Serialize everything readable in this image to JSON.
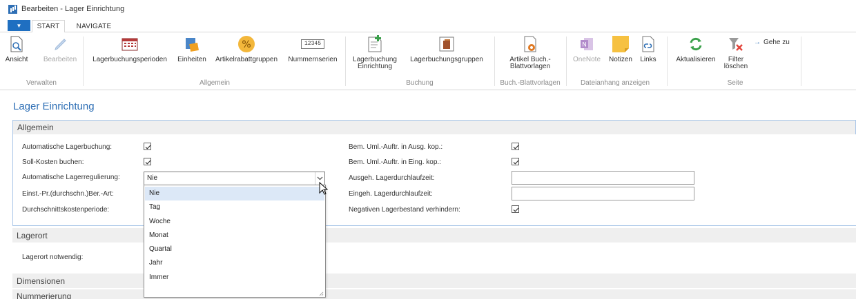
{
  "window": {
    "title": "Bearbeiten - Lager Einrichtung"
  },
  "tabs": {
    "start": "START",
    "navigate": "NAVIGATE"
  },
  "ribbon": {
    "ansicht": "Ansicht",
    "bearbeiten": "Bearbeiten",
    "verwalten": "Verwalten",
    "lagerbuchungsperioden": "Lagerbuchungsperioden",
    "einheiten": "Einheiten",
    "artikelrabattgruppen": "Artikelrabattgruppen",
    "nummernserien": "Nummernserien",
    "nummernserien_icon_text": "12345",
    "allgemein": "Allgemein",
    "lagerbuchung_einrichtung_1": "Lagerbuchung",
    "lagerbuchung_einrichtung_2": "Einrichtung",
    "lagerbuchungsgruppen": "Lagerbuchungsgruppen",
    "buchung": "Buchung",
    "artikel_buch_1": "Artikel Buch.-",
    "artikel_buch_2": "Blattvorlagen",
    "buchblatt_group": "Buch.-Blattvorlagen",
    "onenote": "OneNote",
    "notizen": "Notizen",
    "links": "Links",
    "dateianhang": "Dateianhang anzeigen",
    "aktualisieren": "Aktualisieren",
    "filter_1": "Filter",
    "filter_2": "löschen",
    "gehe_zu": "Gehe zu",
    "seite": "Seite"
  },
  "page": {
    "title": "Lager Einrichtung"
  },
  "sections": {
    "allgemein": "Allgemein",
    "lagerort": "Lagerort",
    "dimensionen": "Dimensionen",
    "nummerierung": "Nummerierung"
  },
  "fields": {
    "auto_lagerbuchung": {
      "label": "Automatische Lagerbuchung:",
      "checked": true
    },
    "soll_kosten": {
      "label": "Soll-Kosten buchen:",
      "checked": true
    },
    "auto_lagerregulierung": {
      "label": "Automatische Lagerregulierung:",
      "value": "Nie"
    },
    "einst_pr": {
      "label": "Einst.-Pr.(durchschn.)Ber.-Art:"
    },
    "durchschnittskostenperiode": {
      "label": "Durchschnittskostenperiode:"
    },
    "bem_ausg": {
      "label": "Bem. Uml.-Auftr. in Ausg. kop.:",
      "checked": true
    },
    "bem_eing": {
      "label": "Bem. Uml.-Auftr. in Eing. kop.:",
      "checked": true
    },
    "ausg_lagerdurchlaufzeit": {
      "label": "Ausgeh. Lagerdurchlaufzeit:",
      "value": ""
    },
    "eing_lagerdurchlaufzeit": {
      "label": "Eingeh. Lagerdurchlaufzeit:",
      "value": ""
    },
    "negativen_lagerbestand": {
      "label": "Negativen Lagerbestand verhindern:",
      "checked": true
    },
    "lagerort_notwendig": {
      "label": "Lagerort notwendig:"
    }
  },
  "dropdown": {
    "options": [
      "Nie",
      "Tag",
      "Woche",
      "Monat",
      "Quartal",
      "Jahr",
      "Immer"
    ],
    "selected": "Nie"
  }
}
